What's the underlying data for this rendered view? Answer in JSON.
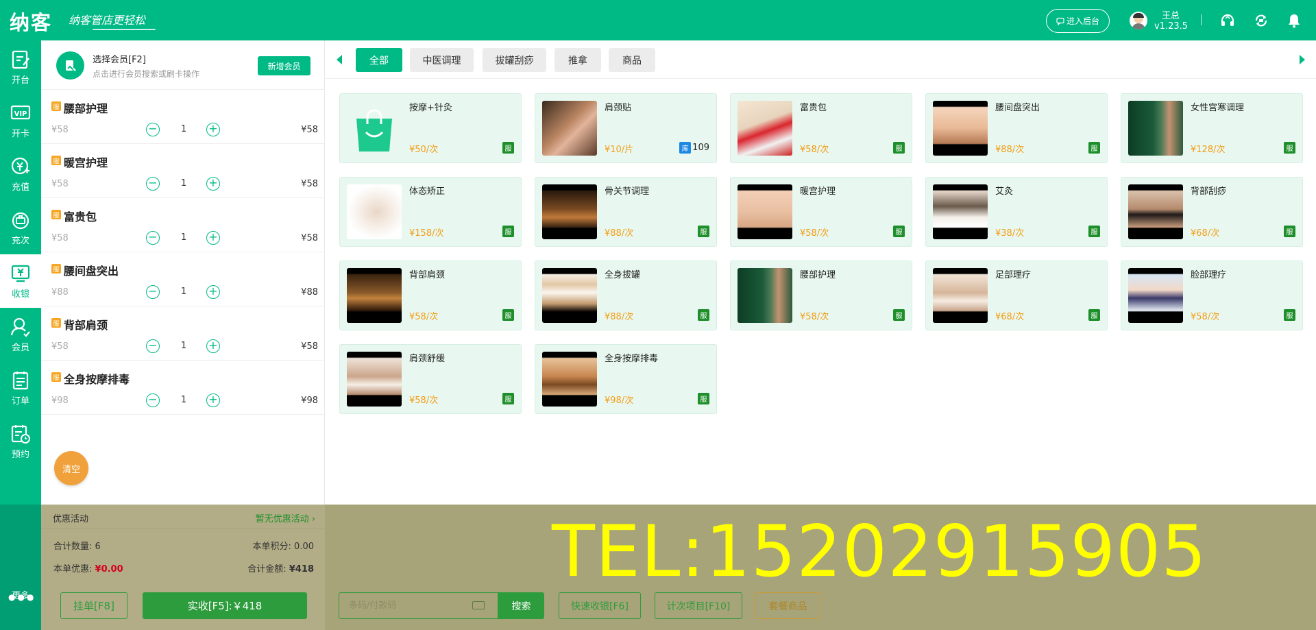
{
  "header": {
    "logo": "纳客",
    "slogan": "纳客管店更轻松",
    "backend_button": "进入后台",
    "user_name": "王总",
    "version": "v1.23.5",
    "icons": [
      "headset-icon",
      "refresh-icon",
      "bell-icon"
    ]
  },
  "sidebar": {
    "items": [
      {
        "label": "开台",
        "icon": "open-table-icon"
      },
      {
        "label": "开卡",
        "icon": "vip-card-icon"
      },
      {
        "label": "充值",
        "icon": "recharge-icon"
      },
      {
        "label": "充次",
        "icon": "recharge-times-icon"
      },
      {
        "label": "收银",
        "icon": "cashier-icon"
      },
      {
        "label": "会员",
        "icon": "member-icon"
      },
      {
        "label": "订单",
        "icon": "order-icon"
      },
      {
        "label": "预约",
        "icon": "appointment-icon"
      }
    ],
    "active": "收银",
    "more_label": "更多"
  },
  "member": {
    "title": "选择会员[F2]",
    "subtitle": "点击进行会员搜索或刷卡操作",
    "new_member_button": "新增会员"
  },
  "cart": {
    "tag": "服",
    "items": [
      {
        "name": "腰部护理",
        "unit_price": "¥58",
        "qty": "1",
        "total": "¥58"
      },
      {
        "name": "暖宫护理",
        "unit_price": "¥58",
        "qty": "1",
        "total": "¥58"
      },
      {
        "name": "富贵包",
        "unit_price": "¥58",
        "qty": "1",
        "total": "¥58"
      },
      {
        "name": "腰间盘突出",
        "unit_price": "¥88",
        "qty": "1",
        "total": "¥88"
      },
      {
        "name": "背部肩颈",
        "unit_price": "¥58",
        "qty": "1",
        "total": "¥58"
      },
      {
        "name": "全身按摩排毒",
        "unit_price": "¥98",
        "qty": "1",
        "total": "¥98"
      }
    ],
    "clear_button": "清空"
  },
  "tabs": [
    {
      "label": "全部",
      "active": true
    },
    {
      "label": "中医调理",
      "active": false
    },
    {
      "label": "拔罐刮痧",
      "active": false
    },
    {
      "label": "推拿",
      "active": false
    },
    {
      "label": "商品",
      "active": false
    }
  ],
  "products": [
    {
      "name": "按摩+针灸",
      "price": "¥50/次",
      "badge": "服",
      "thumb": "bag"
    },
    {
      "name": "肩颈贴",
      "price": "¥10/片",
      "stock_label": "库",
      "stock": "109",
      "thumb": "photo"
    },
    {
      "name": "富贵包",
      "price": "¥58/次",
      "badge": "服",
      "thumb": "photo"
    },
    {
      "name": "腰间盘突出",
      "price": "¥88/次",
      "badge": "服",
      "thumb": "photo"
    },
    {
      "name": "女性宫寒调理",
      "price": "¥128/次",
      "badge": "服",
      "thumb": "photo"
    },
    {
      "name": "体态矫正",
      "price": "¥158/次",
      "badge": "服",
      "thumb": "photo"
    },
    {
      "name": "骨关节调理",
      "price": "¥88/次",
      "badge": "服",
      "thumb": "photo"
    },
    {
      "name": "暖宫护理",
      "price": "¥58/次",
      "badge": "服",
      "thumb": "photo"
    },
    {
      "name": "艾灸",
      "price": "¥38/次",
      "badge": "服",
      "thumb": "photo"
    },
    {
      "name": "背部刮痧",
      "price": "¥68/次",
      "badge": "服",
      "thumb": "photo"
    },
    {
      "name": "背部肩颈",
      "price": "¥58/次",
      "badge": "服",
      "thumb": "photo"
    },
    {
      "name": "全身拔罐",
      "price": "¥88/次",
      "badge": "服",
      "thumb": "photo"
    },
    {
      "name": "腰部护理",
      "price": "¥58/次",
      "badge": "服",
      "thumb": "photo"
    },
    {
      "name": "足部理疗",
      "price": "¥68/次",
      "badge": "服",
      "thumb": "photo"
    },
    {
      "name": "脸部理疗",
      "price": "¥58/次",
      "badge": "服",
      "thumb": "photo"
    },
    {
      "name": "肩颈舒缓",
      "price": "¥58/次",
      "badge": "服",
      "thumb": "photo"
    },
    {
      "name": "全身按摩排毒",
      "price": "¥98/次",
      "badge": "服",
      "thumb": "photo"
    }
  ],
  "summary": {
    "promo_label": "优惠活动",
    "promo_value": "暂无优惠活动",
    "total_qty_label": "合计数量:",
    "total_qty": "6",
    "points_label": "本单积分:",
    "points": "0.00",
    "discount_label": "本单优惠:",
    "discount": "¥0.00",
    "total_amount_label": "合计金额:",
    "total_amount": "¥418"
  },
  "actions": {
    "hang_button": "挂单[F8]",
    "pay_button": "实收[F5]:￥418",
    "search_placeholder": "条码/付款码",
    "search_button": "搜索",
    "quick_cashier": "快速收银[F6]",
    "count_items": "计次项目[F10]",
    "package_items": "套餐商品"
  },
  "watermark": "TEL:15202915905",
  "colors": {
    "primary": "#00ba86",
    "price": "#f39c12",
    "service_badge": "#1e8f2a",
    "stock_badge": "#1e88e5",
    "watermark": "#ffff00"
  }
}
